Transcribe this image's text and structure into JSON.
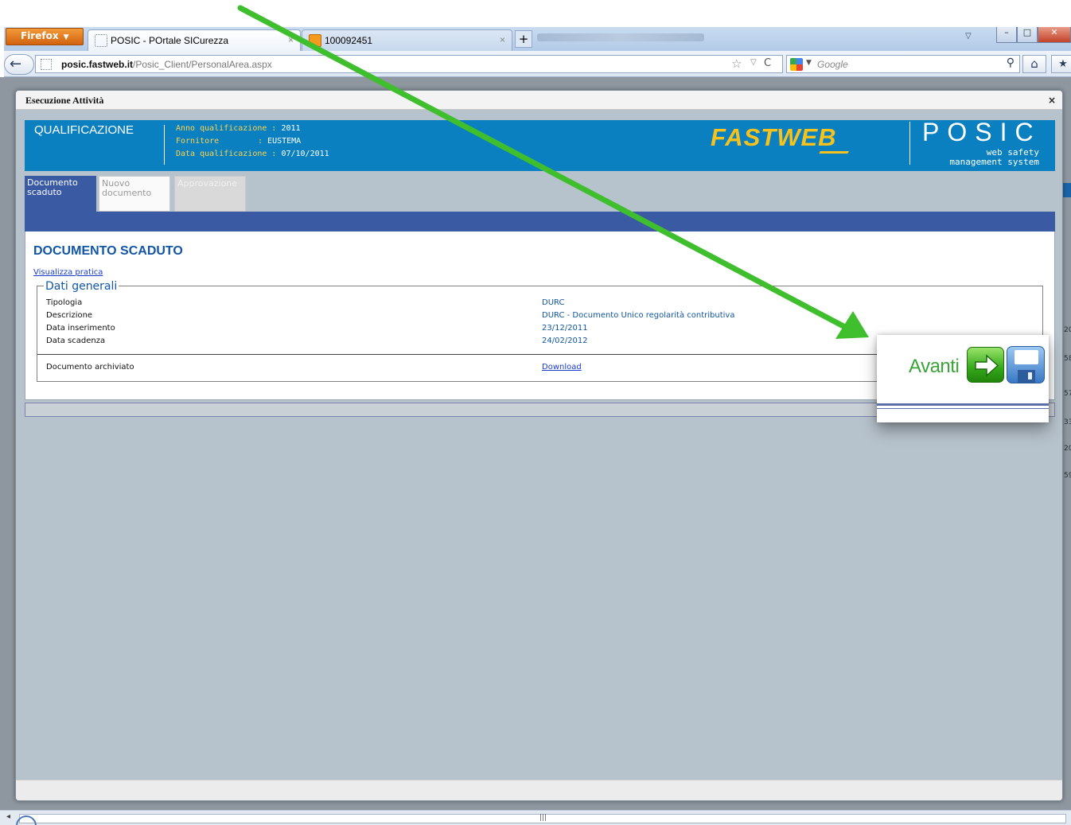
{
  "browser": {
    "menu_label": "Firefox",
    "tabs": [
      {
        "title": "POSIC - POrtale SICurezza",
        "active": true
      },
      {
        "title": "100092451",
        "active": false
      }
    ],
    "new_tab_glyph": "+",
    "url_host": "posic.fastweb.it",
    "url_path": "/Posic_Client/PersonalArea.aspx",
    "search_placeholder": "Google"
  },
  "modal": {
    "title": "Esecuzione Attività",
    "header": {
      "section": "QUALIFICAZIONE",
      "fields": [
        {
          "label": "Anno qualificazione",
          "value": "2011"
        },
        {
          "label": "Fornitore",
          "value": "EUSTEMA"
        },
        {
          "label": "Data qualificazione",
          "value": "07/10/2011"
        }
      ],
      "brand": "FASTWEB",
      "product": "POSIC",
      "product_tagline_1": "web safety",
      "product_tagline_2": "management system"
    },
    "tabs": [
      {
        "label": "Documento scaduto",
        "state": "active"
      },
      {
        "label": "Nuovo documento",
        "state": "inactive"
      },
      {
        "label": "Approvazione",
        "state": "disabled"
      }
    ],
    "panel": {
      "heading": "DOCUMENTO SCADUTO",
      "view_link": "Visualizza pratica",
      "legend": "Dati generali",
      "rows": [
        {
          "label": "Tipologia",
          "value": "DURC"
        },
        {
          "label": "Descrizione",
          "value": "DURC - Documento Unico regolarità contributiva"
        },
        {
          "label": "Data inserimento",
          "value": "23/12/2011"
        },
        {
          "label": "Data scadenza",
          "value": "24/02/2012"
        }
      ],
      "archived_label": "Documento archiviato",
      "download_link": "Download"
    }
  },
  "callout": {
    "next_label": "Avanti"
  },
  "background_numbers": [
    "20",
    "58",
    "57",
    "33",
    "20",
    "59"
  ],
  "colors": {
    "header_blue": "#0a80c1",
    "tab_blue": "#3a5ba4",
    "brand_yellow": "#f6c21b",
    "arrow_green": "#3fbe2e"
  }
}
